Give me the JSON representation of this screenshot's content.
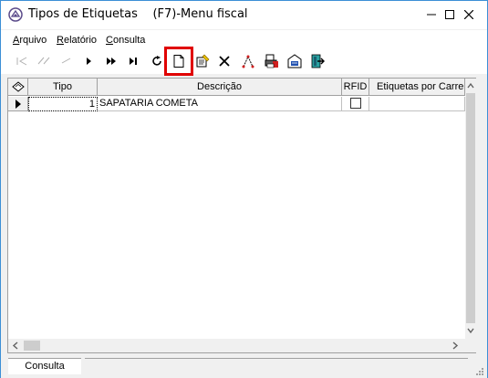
{
  "window": {
    "title": "Tipos de Etiquetas",
    "shortcut": "(F7)-Menu fiscal",
    "border_color": "#3c8fd6"
  },
  "menu": {
    "items": [
      "Arquivo",
      "Relatório",
      "Consulta"
    ]
  },
  "toolbar": {
    "tools": [
      {
        "name": "first-record-icon",
        "enabled": false
      },
      {
        "name": "prior-page-icon",
        "enabled": false
      },
      {
        "name": "prior-record-icon",
        "enabled": false
      },
      {
        "name": "next-record-icon",
        "enabled": true
      },
      {
        "name": "next-page-icon",
        "enabled": true
      },
      {
        "name": "last-record-icon",
        "enabled": true
      },
      {
        "name": "refresh-icon",
        "enabled": true
      },
      {
        "name": "new-record-icon",
        "enabled": true,
        "highlighted": true,
        "highlight_color": "#e00000"
      },
      {
        "name": "edit-record-icon",
        "enabled": true
      },
      {
        "name": "delete-icon",
        "enabled": true
      },
      {
        "name": "clear-icon",
        "enabled": true
      },
      {
        "name": "print-icon",
        "enabled": true
      },
      {
        "name": "properties-icon",
        "enabled": true
      },
      {
        "name": "exit-icon",
        "enabled": true
      }
    ]
  },
  "grid": {
    "columns": [
      "Tipo",
      "Descrição",
      "RFID",
      "Etiquetas por Carre"
    ],
    "rows": [
      {
        "tipo": "1",
        "descricao": "SAPATARIA COMETA",
        "rfid": false,
        "etiquetas": ""
      }
    ]
  },
  "status": {
    "panel": "Consulta"
  }
}
